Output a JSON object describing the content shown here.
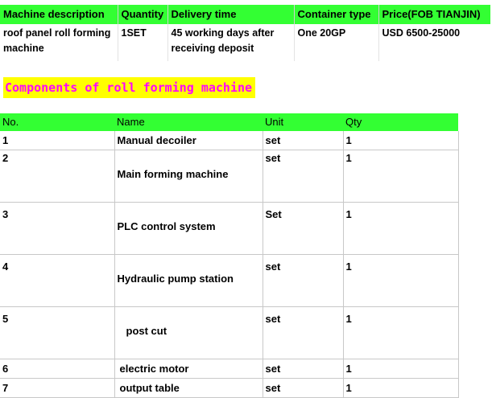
{
  "top_table": {
    "headers": [
      "Machine description",
      "Quantity",
      "Delivery time",
      "Container type",
      "Price(FOB TIANJIN)"
    ],
    "row": {
      "description": "roof panel roll forming machine",
      "quantity": "1SET",
      "delivery": "45 working days after receiving deposit",
      "container": "One 20GP",
      "price": "USD 6500-25000"
    }
  },
  "section_title": "Components of roll forming machine",
  "components": {
    "headers": {
      "no": "No.",
      "name": "Name",
      "unit": "Unit",
      "qty": "Qty"
    },
    "rows": [
      {
        "no": "1",
        "name": "Manual decoiler",
        "unit": "set",
        "qty": "1"
      },
      {
        "no": "2",
        "name": "Main forming machine",
        "unit": "set",
        "qty": "1"
      },
      {
        "no": "3",
        "name": "PLC control system",
        "unit": "Set",
        "qty": "1"
      },
      {
        "no": "4",
        "name": "Hydraulic pump station",
        "unit": "set",
        "qty": "1"
      },
      {
        "no": "5",
        "name": "post cut",
        "unit": "set",
        "qty": "1"
      },
      {
        "no": "6",
        "name": "electric motor",
        "unit": "set",
        "qty": "1"
      },
      {
        "no": "7",
        "name": "output table",
        "unit": "set",
        "qty": "1"
      }
    ]
  },
  "colors": {
    "header_green": "#33ff33",
    "title_yellow": "#ffff00",
    "title_magenta": "#ff00ff"
  }
}
